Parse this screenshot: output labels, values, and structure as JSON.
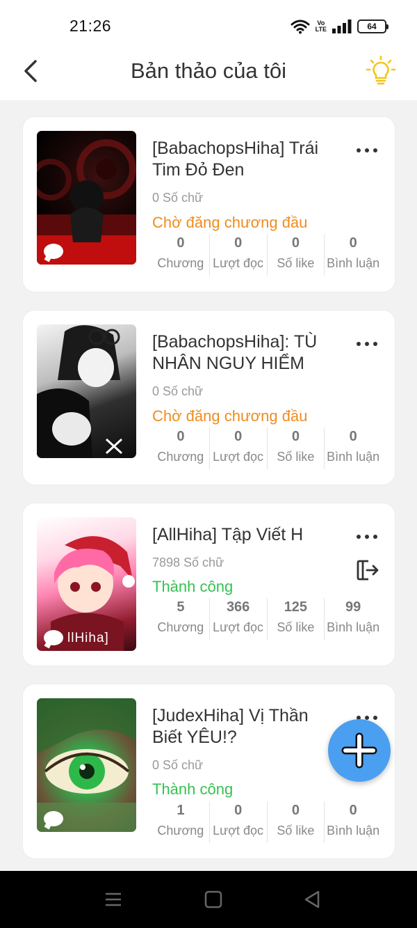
{
  "status_bar": {
    "time": "21:26",
    "battery": "64",
    "volte_top": "Vo",
    "volte_bottom": "LTE"
  },
  "header": {
    "title": "Bản thảo của tôi"
  },
  "stat_labels": [
    "Chương",
    "Lượt đọc",
    "Số like",
    "Bình luận"
  ],
  "stories": [
    {
      "title": "[BabachopsHiha] Trái Tim Đỏ Đen",
      "word_count": "0 Số chữ",
      "status": "Chờ đăng chương đầu",
      "status_type": "pending",
      "stats": [
        "0",
        "0",
        "0",
        "0"
      ]
    },
    {
      "title": "[BabachopsHiha]: TÙ NHÂN NGUY HIỂM",
      "word_count": "0 Số chữ",
      "status": "Chờ đăng chương đầu",
      "status_type": "pending",
      "stats": [
        "0",
        "0",
        "0",
        "0"
      ]
    },
    {
      "title": "[AllHiha] Tập Viết H",
      "word_count": "7898 Số chữ",
      "status": "Thành công",
      "status_type": "success",
      "stats": [
        "5",
        "366",
        "125",
        "99"
      ],
      "cover_text": "llHiha]"
    },
    {
      "title": "[JudexHiha] Vị Thần Biết YÊU!?",
      "word_count": "0 Số chữ",
      "status": "Thành công",
      "status_type": "success",
      "stats": [
        "1",
        "0",
        "0",
        "0"
      ]
    }
  ],
  "colors": {
    "pending": "#ef8c1e",
    "success": "#36c152",
    "fab": "#4a9ff1",
    "bulb": "#f5c518"
  },
  "icons": [
    "back-arrow-icon",
    "lightbulb-icon",
    "more-icon",
    "export-icon",
    "plus-icon",
    "chat-bubble-icon",
    "menu-icon",
    "home-icon",
    "back-triangle-icon"
  ]
}
